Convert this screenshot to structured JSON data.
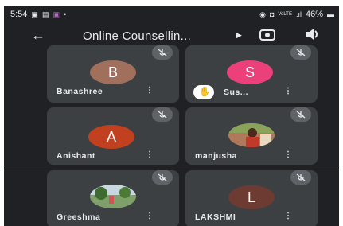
{
  "status_bar": {
    "time": "5:54",
    "carrier": "VoLTE",
    "battery": "46%"
  },
  "app_bar": {
    "title": "Online Counsellin..."
  },
  "participants": [
    {
      "name": "Banashree",
      "initial": "B",
      "avatar_color": "#a0705c",
      "muted": true
    },
    {
      "name": "Sus...",
      "initial": "S",
      "avatar_color": "#ec407a",
      "muted": true,
      "hand_raised": true
    },
    {
      "name": "Anishant",
      "initial": "A",
      "avatar_color": "#c1401f",
      "muted": true
    },
    {
      "name": "manjusha",
      "initial": "",
      "muted": true,
      "photo": true
    },
    {
      "name": "Greeshma",
      "initial": "",
      "muted": true,
      "photo": true
    },
    {
      "name": "LAKSHMI",
      "initial": "L",
      "avatar_color": "#6d3b31",
      "muted": true
    }
  ],
  "icons": {
    "back": "arrow-left-icon",
    "more": "more-vert-icon",
    "mute": "mic-off-icon",
    "hand": "raised-hand-icon"
  },
  "colors": {
    "background": "#202124",
    "tile": "#3c4043"
  }
}
